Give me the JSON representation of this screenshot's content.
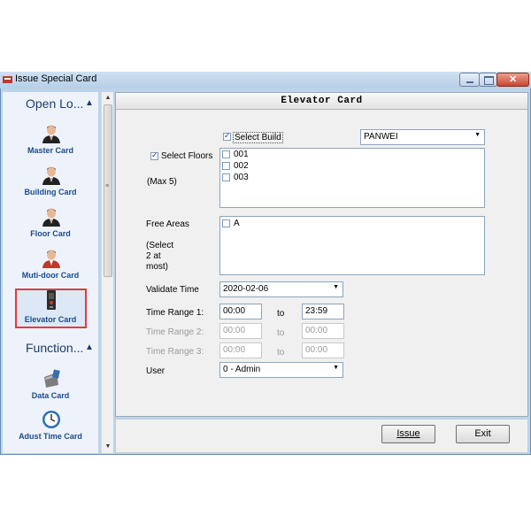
{
  "window": {
    "title": "Issue Special Card"
  },
  "sidebar": {
    "groups": [
      {
        "label": "Open Lo...",
        "chevron": "^"
      },
      {
        "label": "Function...",
        "chevron": "^"
      }
    ],
    "items": [
      {
        "label": "Master Card",
        "icon": "user-icon"
      },
      {
        "label": "Building Card",
        "icon": "user-icon"
      },
      {
        "label": "Floor Card",
        "icon": "user-icon"
      },
      {
        "label": "Muti-door Card",
        "icon": "user-icon"
      },
      {
        "label": "Elevator Card",
        "icon": "elevator-icon",
        "selected": true
      },
      {
        "label": "Data Card",
        "icon": "card-reader-icon"
      },
      {
        "label": "Adust Time Card",
        "icon": "clock-icon"
      }
    ]
  },
  "panel": {
    "title": "Elevator Card"
  },
  "form": {
    "select_build_label": "Select Build",
    "build_value": "PANWEI",
    "select_floors_label": "Select Floors",
    "max_label": "(Max 5)",
    "floors": [
      "001",
      "002",
      "003"
    ],
    "free_areas_label": "Free Areas",
    "select_note": [
      "(Select",
      "2 at",
      "most)"
    ],
    "areas": [
      "A"
    ],
    "validate_label": "Validate Time",
    "validate_value": "2020-02-06",
    "ranges": [
      {
        "label": "Time Range 1:",
        "from": "00:00",
        "to": "23:59",
        "enabled": true
      },
      {
        "label": "Time Range 2:",
        "from": "00:00",
        "to": "00:00",
        "enabled": false
      },
      {
        "label": "Time Range 3:",
        "from": "00:00",
        "to": "00:00",
        "enabled": false
      }
    ],
    "to_label": "to",
    "user_label": "User",
    "user_value": "0 - Admin"
  },
  "buttons": {
    "issue": "Issue",
    "exit": "Exit"
  },
  "colors": {
    "title_bar": "#bcd3ea",
    "accent": "#1b4a8a",
    "selection": "#e23b3b"
  }
}
